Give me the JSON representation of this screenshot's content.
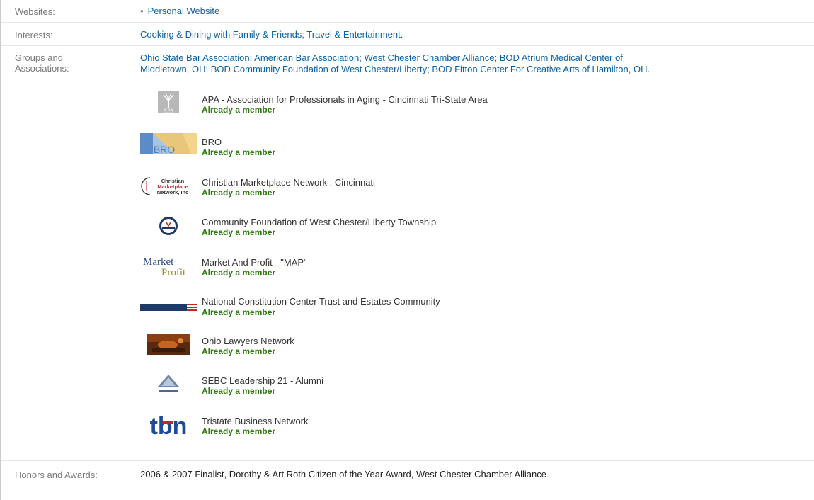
{
  "websites": {
    "label": "Websites:",
    "bullet": "•",
    "items": [
      "Personal Website"
    ]
  },
  "interests": {
    "label": "Interests:",
    "text": "Cooking & Dining with Family & Friends; Travel & Entertainment."
  },
  "groups_text": {
    "label_line1": "Groups and",
    "label_line2": "Associations:",
    "line1": "Ohio State Bar Association; American Bar Association; West Chester Chamber Alliance; BOD Atrium Medical Center of",
    "line2_a": "Middletown",
    "line2_sep1": ", ",
    "line2_b": "OH",
    "line2_c": "; BOD Community Foundation of West Chester/Liberty; BOD Fitton Center For Creative Arts of Hamilton",
    "line2_sep2": ", ",
    "line2_d": "OH."
  },
  "groups": [
    {
      "name": "APA - Association for Professionals in Aging - Cincinnati Tri-State Area",
      "status": "Already a member",
      "logo_text": "APA"
    },
    {
      "name": "BRO",
      "status": "Already a member",
      "logo_text": "BRO"
    },
    {
      "name": "Christian Marketplace Network : Cincinnati",
      "status": "Already a member",
      "logo_text_1": "Christian",
      "logo_text_2": "Marketplace",
      "logo_text_3": "Network, Inc"
    },
    {
      "name": "Community Foundation of West Chester/Liberty Township",
      "status": "Already a member"
    },
    {
      "name": "Market And Profit - \"MAP\"",
      "status": "Already a member",
      "logo_text_1": "Market",
      "logo_text_2": "Profit"
    },
    {
      "name": "National Constitution Center Trust and Estates Community",
      "status": "Already a member"
    },
    {
      "name": "Ohio Lawyers Network",
      "status": "Already a member"
    },
    {
      "name": "SEBC Leadership 21 - Alumni",
      "status": "Already a member"
    },
    {
      "name": "Tristate Business Network",
      "status": "Already a member",
      "logo_text": "tbn"
    }
  ],
  "honors": {
    "label": "Honors and Awards:",
    "text": "2006 & 2007 Finalist, Dorothy & Art Roth Citizen of the Year Award, West Chester Chamber Alliance"
  },
  "colors": {
    "link": "#0b63a5",
    "member_green": "#2d7a0e",
    "label_grey": "#7a7a7a"
  }
}
